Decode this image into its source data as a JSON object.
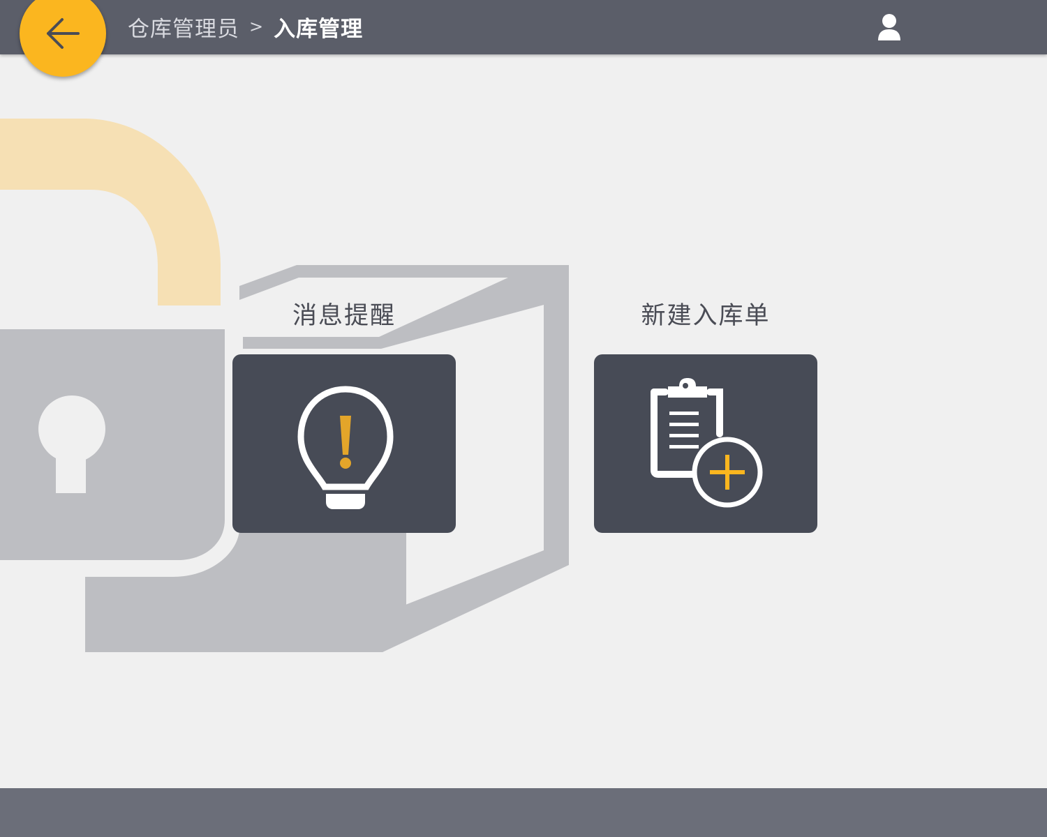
{
  "header": {
    "breadcrumb_parent": "仓库管理员",
    "breadcrumb_separator": ">",
    "breadcrumb_current": "入库管理",
    "back_icon": "arrow-left-icon",
    "user_icon": "user-icon"
  },
  "tiles": [
    {
      "label": "消息提醒",
      "icon": "lightbulb-alert-icon"
    },
    {
      "label": "新建入库单",
      "icon": "clipboard-add-icon"
    }
  ],
  "colors": {
    "header_bg": "#5b5e69",
    "accent": "#fbb61f",
    "tile_bg": "#474b56",
    "page_bg": "#f0f0f0",
    "footer_bg": "#6b6e79"
  }
}
